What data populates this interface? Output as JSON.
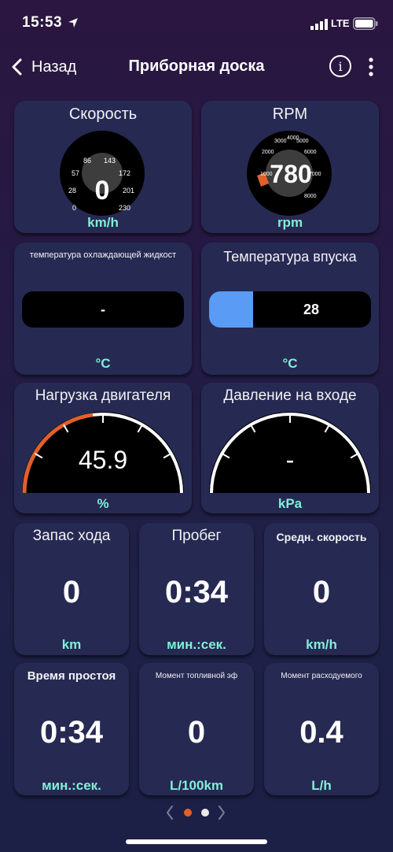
{
  "status_bar": {
    "time": "15:53",
    "network": "LTE",
    "icons": [
      "location-arrow-icon",
      "signal-icon",
      "battery-icon"
    ]
  },
  "nav": {
    "back_label": "Назад",
    "title": "Приборная доска",
    "info_icon": "i",
    "icons": [
      "chevron-left-icon",
      "info-icon",
      "more-vertical-icon"
    ]
  },
  "colors": {
    "accent_teal": "#7ff0d8",
    "tile_bg": "#262a52",
    "gauge_orange": "#e0602c",
    "bar_blue": "#5a9bf5",
    "pager_active": "#e0602c"
  },
  "speed": {
    "title": "Скорость",
    "value": "0",
    "unit": "km/h",
    "scale_labels": [
      "0",
      "28",
      "57",
      "86",
      "143",
      "172",
      "201",
      "230"
    ]
  },
  "rpm": {
    "title": "RPM",
    "value": "780",
    "unit": "rpm",
    "scale_labels": [
      "1000",
      "2000",
      "3000",
      "4000",
      "5000",
      "6000",
      "7000",
      "8000"
    ],
    "level": 0.1
  },
  "coolant": {
    "title": "температура охлаждающей жидкост",
    "value": "-",
    "unit": "°C"
  },
  "intake": {
    "title": "Температура впуска",
    "value": "28",
    "unit": "°C",
    "level": 0.27
  },
  "load": {
    "title": "Нагрузка двигателя",
    "value": "45.9",
    "unit": "%",
    "level": 0.459
  },
  "pressure": {
    "title": "Давление на входе",
    "value": "-",
    "unit": "kPa"
  },
  "range": {
    "title": "Запас хода",
    "value": "0",
    "unit": "km"
  },
  "mileage": {
    "title": "Пробег",
    "value": "0:34",
    "unit": "мин.:сек."
  },
  "avg_speed": {
    "title": "Средн. скорость",
    "value": "0",
    "unit": "km/h"
  },
  "idle_time": {
    "title": "Время простоя",
    "value": "0:34",
    "unit": "мин.:сек."
  },
  "fuel_eff": {
    "title": "Момент топливной эф",
    "value": "0",
    "unit": "L/100km"
  },
  "fuel_flow": {
    "title": "Момент расходуемого",
    "value": "0.4",
    "unit": "L/h"
  },
  "pager": {
    "pages": 2,
    "current": 1
  }
}
